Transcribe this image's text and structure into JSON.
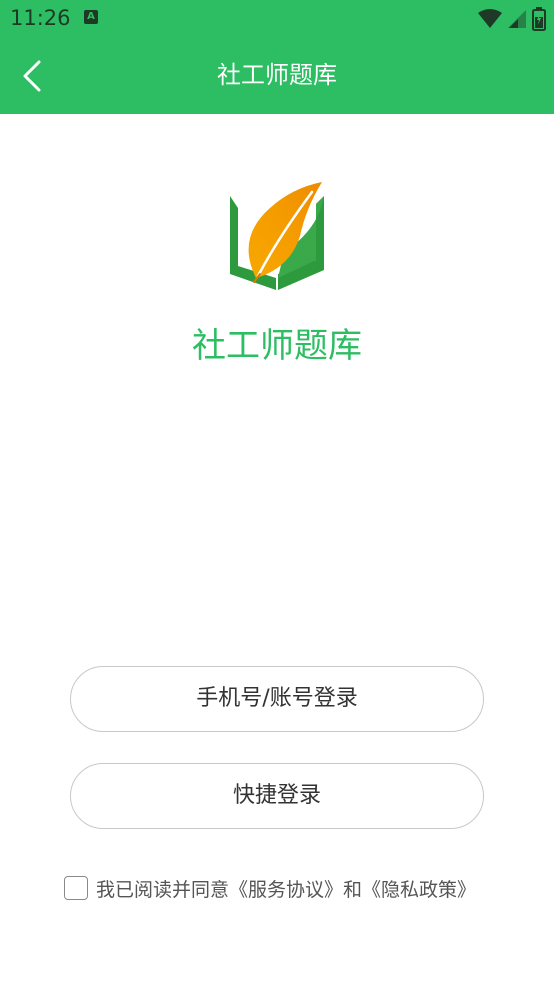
{
  "status_bar": {
    "time": "11:26",
    "notification_icon": "a-icon",
    "icons": [
      "wifi-icon",
      "signal-icon",
      "battery-icon"
    ]
  },
  "nav": {
    "back_icon": "chevron-left-icon",
    "title": "社工师题库"
  },
  "brand": {
    "logo_icon": "book-leaf-logo",
    "app_name": "社工师题库"
  },
  "actions": {
    "phone_login_label": "手机号/账号登录",
    "quick_login_label": "快捷登录"
  },
  "agreement": {
    "checked": false,
    "prefix": "我已阅读并同意",
    "service_agreement": "《服务协议》",
    "conjunction": "和",
    "privacy_policy": "《隐私政策》"
  },
  "colors": {
    "primary": "#2dbd62",
    "button_border": "#c8c8c8",
    "text": "#333333"
  }
}
